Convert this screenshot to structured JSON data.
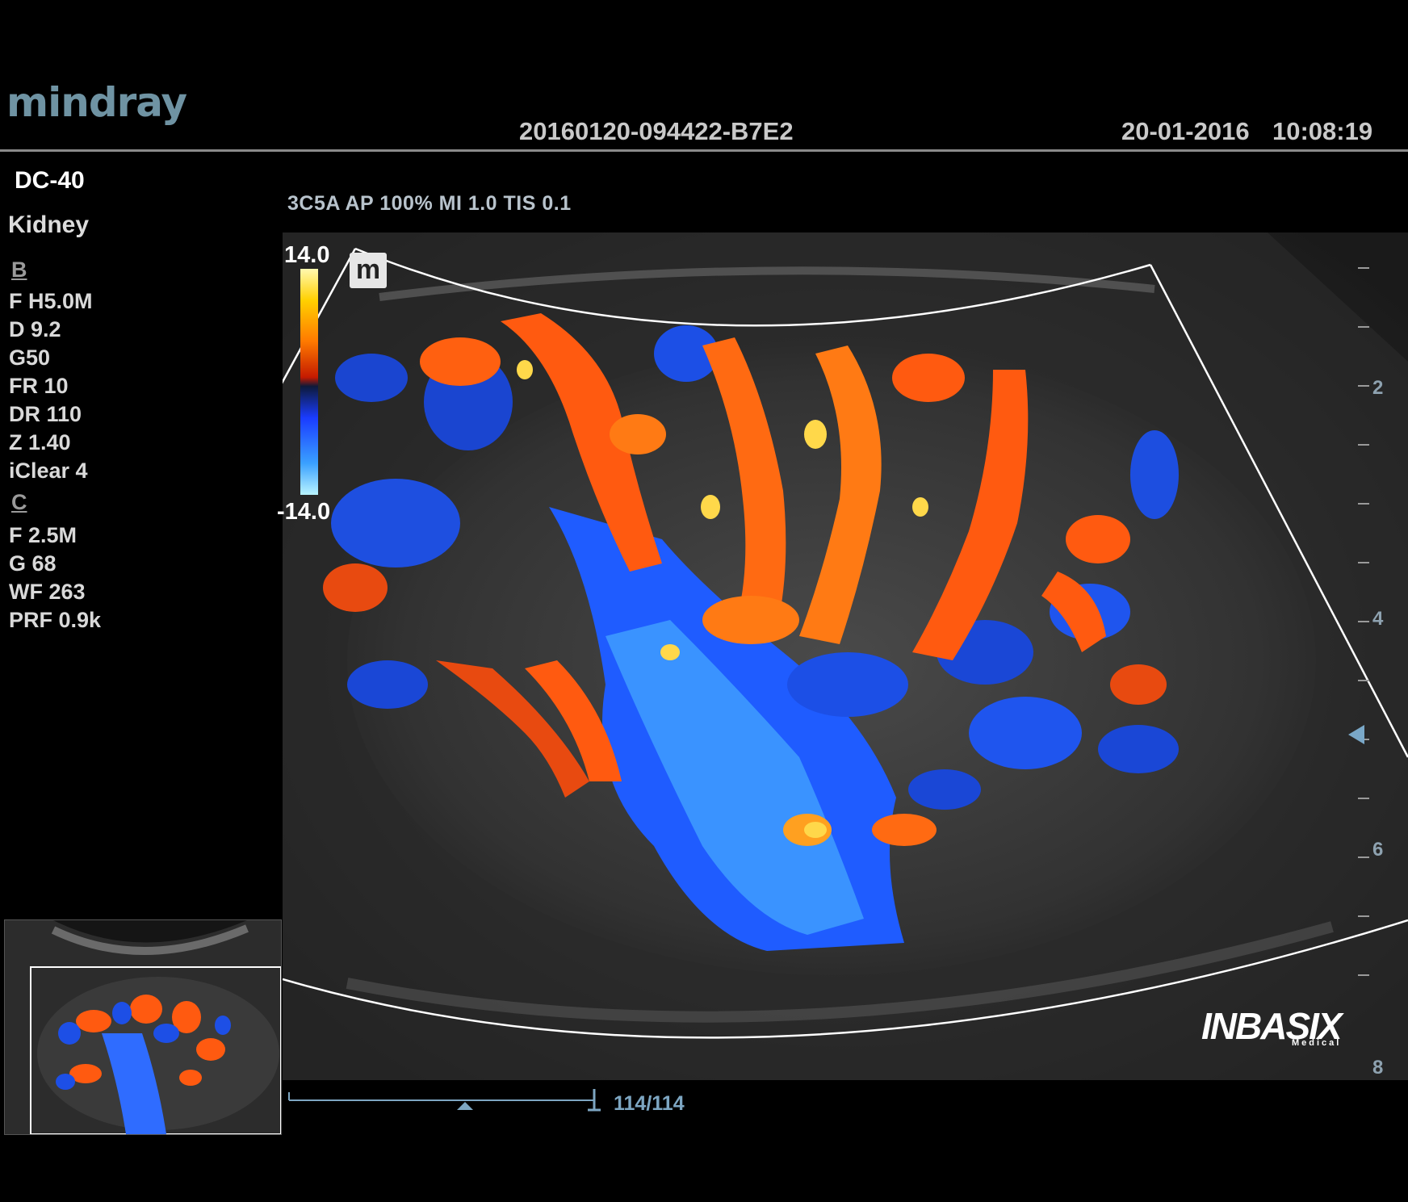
{
  "header": {
    "brand": "mindray",
    "exam_id": "20160120-094422-B7E2",
    "date": "20-01-2016",
    "time": "10:08:19"
  },
  "device": {
    "model": "DC-40",
    "preset": "Kidney"
  },
  "probe_line": "3C5A  AP 100%  MI 1.0 TIS 0.1",
  "b_mode": {
    "label": "B",
    "params": [
      "F H5.0M",
      "D 9.2",
      "G50",
      "FR 10",
      "DR 110",
      "Z 1.40",
      "iClear 4"
    ]
  },
  "c_mode": {
    "label": "C",
    "params": [
      "F 2.5M",
      "G 68",
      "WF 263",
      "PRF 0.9k"
    ]
  },
  "color_scale": {
    "max": "14.0",
    "min": "-14.0"
  },
  "orientation_mark": "m",
  "depth_scale": {
    "labels": [
      "2",
      "4",
      "6",
      "8"
    ]
  },
  "cine": {
    "frame_counter": "114/114"
  },
  "watermark": {
    "brand": "INBASIX",
    "sub": "Medical"
  },
  "colors": {
    "brand": "#6f93a3",
    "header_text": "#c9c9c9",
    "cine": "#7da6c2",
    "doppler_red": "#ff5a10",
    "doppler_blue": "#1f5cff"
  },
  "icons": [
    "orientation-mark-icon",
    "color-scale-bar",
    "cine-marker-icon",
    "focus-arrow-icon"
  ]
}
